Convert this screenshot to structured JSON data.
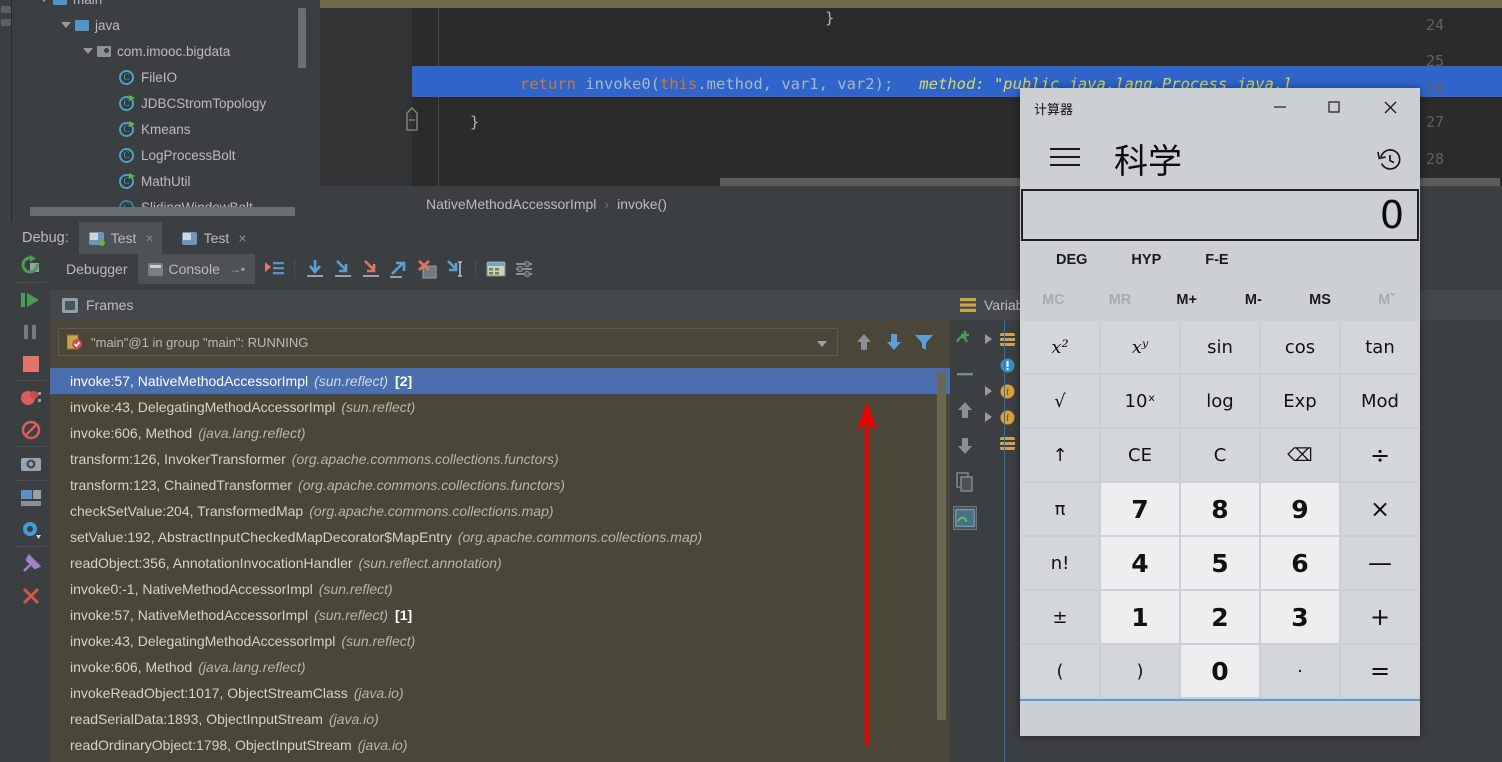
{
  "ide": {
    "project_tree": {
      "items": [
        {
          "label": "main",
          "indent": 0,
          "icon": "folder-icon",
          "twisty": "down",
          "partial": true
        },
        {
          "label": "java",
          "indent": 1,
          "icon": "folder-icon",
          "twisty": "down"
        },
        {
          "label": "com.imooc.bigdata",
          "indent": 2,
          "icon": "package-icon",
          "twisty": "down"
        },
        {
          "label": "FileIO",
          "indent": 3,
          "icon": "class-icon"
        },
        {
          "label": "JDBCStromTopology",
          "indent": 3,
          "icon": "class-runnable-icon"
        },
        {
          "label": "Kmeans",
          "indent": 3,
          "icon": "class-runnable-icon"
        },
        {
          "label": "LogProcessBolt",
          "indent": 3,
          "icon": "class-icon"
        },
        {
          "label": "MathUtil",
          "indent": 3,
          "icon": "class-runnable-icon"
        },
        {
          "label": "SlidingWindowBolt",
          "indent": 3,
          "icon": "class-icon"
        }
      ]
    },
    "editor": {
      "line_numbers": [
        "24",
        "25",
        "26",
        "27",
        "28"
      ],
      "lines": [
        {
          "num": "24",
          "text": "}"
        },
        {
          "num": "25",
          "text": ""
        },
        {
          "num": "26",
          "text": "return invoke0(this.method, var1, var2);",
          "highlighted": true
        },
        {
          "num": "27",
          "text": "}"
        },
        {
          "num": "28",
          "text": ""
        }
      ],
      "code_keyword_return": "return",
      "code_call": "invoke0(",
      "code_keyword_this": "this",
      "code_args": ".method, var1, var2);",
      "inline_hint": "method: \"public java.lang.Process java.l",
      "breadcrumb": {
        "class": "NativeMethodAccessorImpl",
        "separator": "›",
        "method": "invoke()"
      }
    },
    "debug_header": {
      "label": "Debug:",
      "tabs": [
        {
          "label": "Test",
          "active": true,
          "close": "×"
        },
        {
          "label": "Test",
          "active": false,
          "close": "×"
        }
      ]
    },
    "debug_tabs": {
      "debugger": "Debugger",
      "console": "Console",
      "console_pin": "→▪"
    },
    "run_toolbar_icons": [
      "rerun-icon",
      "resume-program-icon",
      "pause-program-icon",
      "stop-icon",
      "view-breakpoints-icon",
      "mute-breakpoints-icon",
      "camera-icon",
      "restore-layout-icon",
      "settings-gear-icon",
      "pin-tab-icon",
      "close-icon"
    ],
    "stepping_toolbar_icons": [
      "show-execution-point-icon",
      "step-over-icon",
      "step-into-icon",
      "force-step-into-icon",
      "step-out-icon",
      "drop-frame-icon",
      "run-to-cursor-icon",
      "evaluate-expression-icon",
      "settings-icon"
    ],
    "frames": {
      "title": "Frames",
      "thread": "\"main\"@1 in group \"main\": RUNNING",
      "toolbar_icons": [
        "frame-up-icon",
        "frame-down-icon",
        "filter-icon"
      ],
      "rows": [
        {
          "method": "invoke:57",
          "cls": "NativeMethodAccessorImpl",
          "pkg": "(sun.reflect)",
          "badge": "[2]",
          "selected": true
        },
        {
          "method": "invoke:43",
          "cls": "DelegatingMethodAccessorImpl",
          "pkg": "(sun.reflect)",
          "badge": ""
        },
        {
          "method": "invoke:606",
          "cls": "Method",
          "pkg": "(java.lang.reflect)",
          "badge": ""
        },
        {
          "method": "transform:126",
          "cls": "InvokerTransformer",
          "pkg": "(org.apache.commons.collections.functors)",
          "badge": ""
        },
        {
          "method": "transform:123",
          "cls": "ChainedTransformer",
          "pkg": "(org.apache.commons.collections.functors)",
          "badge": ""
        },
        {
          "method": "checkSetValue:204",
          "cls": "TransformedMap",
          "pkg": "(org.apache.commons.collections.map)",
          "badge": ""
        },
        {
          "method": "setValue:192",
          "cls": "AbstractInputCheckedMapDecorator$MapEntry",
          "pkg": "(org.apache.commons.collections.map)",
          "badge": ""
        },
        {
          "method": "readObject:356",
          "cls": "AnnotationInvocationHandler",
          "pkg": "(sun.reflect.annotation)",
          "badge": ""
        },
        {
          "method": "invoke0:-1",
          "cls": "NativeMethodAccessorImpl",
          "pkg": "(sun.reflect)",
          "badge": ""
        },
        {
          "method": "invoke:57",
          "cls": "NativeMethodAccessorImpl",
          "pkg": "(sun.reflect)",
          "badge": "[1]"
        },
        {
          "method": "invoke:43",
          "cls": "DelegatingMethodAccessorImpl",
          "pkg": "(sun.reflect)",
          "badge": ""
        },
        {
          "method": "invoke:606",
          "cls": "Method",
          "pkg": "(java.lang.reflect)",
          "badge": ""
        },
        {
          "method": "invokeReadObject:1017",
          "cls": "ObjectStreamClass",
          "pkg": "(java.io)",
          "badge": ""
        },
        {
          "method": "readSerialData:1893",
          "cls": "ObjectInputStream",
          "pkg": "(java.io)",
          "badge": ""
        },
        {
          "method": "readOrdinaryObject:1798",
          "cls": "ObjectInputStream",
          "pkg": "(java.io)",
          "badge": ""
        }
      ]
    },
    "variables": {
      "title": "Variab",
      "toolbar_icons": [
        "new-watch-icon",
        "remove-watch-icon",
        "watch-up-icon",
        "watch-down-icon",
        "copy-value-icon",
        "evaluate-icon"
      ]
    },
    "annotation": {
      "arrow": "red-up-arrow",
      "color": "#ee0000"
    }
  },
  "calculator": {
    "window_title": "计算器",
    "window_buttons": {
      "minimize": "—",
      "maximize": "□",
      "close": "✕"
    },
    "menu_icon": "hamburger-menu-icon",
    "mode": "科学",
    "history_icon": "history-icon",
    "display_value": "0",
    "mode_row": [
      "DEG",
      "HYP",
      "F-E"
    ],
    "memory_row": [
      {
        "label": "MC",
        "disabled": true
      },
      {
        "label": "MR",
        "disabled": true
      },
      {
        "label": "M+",
        "disabled": false
      },
      {
        "label": "M-",
        "disabled": false
      },
      {
        "label": "MS",
        "disabled": false
      },
      {
        "label": "Mˇ",
        "disabled": true
      }
    ],
    "keys": [
      {
        "label": "x²",
        "type": "sci-ital"
      },
      {
        "label": "xʸ",
        "type": "sci-ital"
      },
      {
        "label": "sin",
        "type": "sci"
      },
      {
        "label": "cos",
        "type": "sci"
      },
      {
        "label": "tan",
        "type": "sci"
      },
      {
        "label": "√",
        "type": "sci"
      },
      {
        "label": "10ˣ",
        "type": "sci"
      },
      {
        "label": "log",
        "type": "sci"
      },
      {
        "label": "Exp",
        "type": "sci"
      },
      {
        "label": "Mod",
        "type": "sci"
      },
      {
        "label": "↑",
        "type": "sci"
      },
      {
        "label": "CE",
        "type": "sci"
      },
      {
        "label": "C",
        "type": "sci"
      },
      {
        "label": "⌫",
        "type": "sci"
      },
      {
        "label": "÷",
        "type": "big"
      },
      {
        "label": "π",
        "type": "sci"
      },
      {
        "label": "7",
        "type": "num"
      },
      {
        "label": "8",
        "type": "num"
      },
      {
        "label": "9",
        "type": "num"
      },
      {
        "label": "×",
        "type": "big"
      },
      {
        "label": "n!",
        "type": "sci"
      },
      {
        "label": "4",
        "type": "num"
      },
      {
        "label": "5",
        "type": "num"
      },
      {
        "label": "6",
        "type": "num"
      },
      {
        "label": "—",
        "type": "big"
      },
      {
        "label": "±",
        "type": "sci"
      },
      {
        "label": "1",
        "type": "num"
      },
      {
        "label": "2",
        "type": "num"
      },
      {
        "label": "3",
        "type": "num"
      },
      {
        "label": "+",
        "type": "big"
      },
      {
        "label": "(",
        "type": "sci"
      },
      {
        "label": ")",
        "type": "sci"
      },
      {
        "label": "0",
        "type": "num"
      },
      {
        "label": "·",
        "type": "sci"
      },
      {
        "label": "=",
        "type": "big"
      }
    ]
  }
}
